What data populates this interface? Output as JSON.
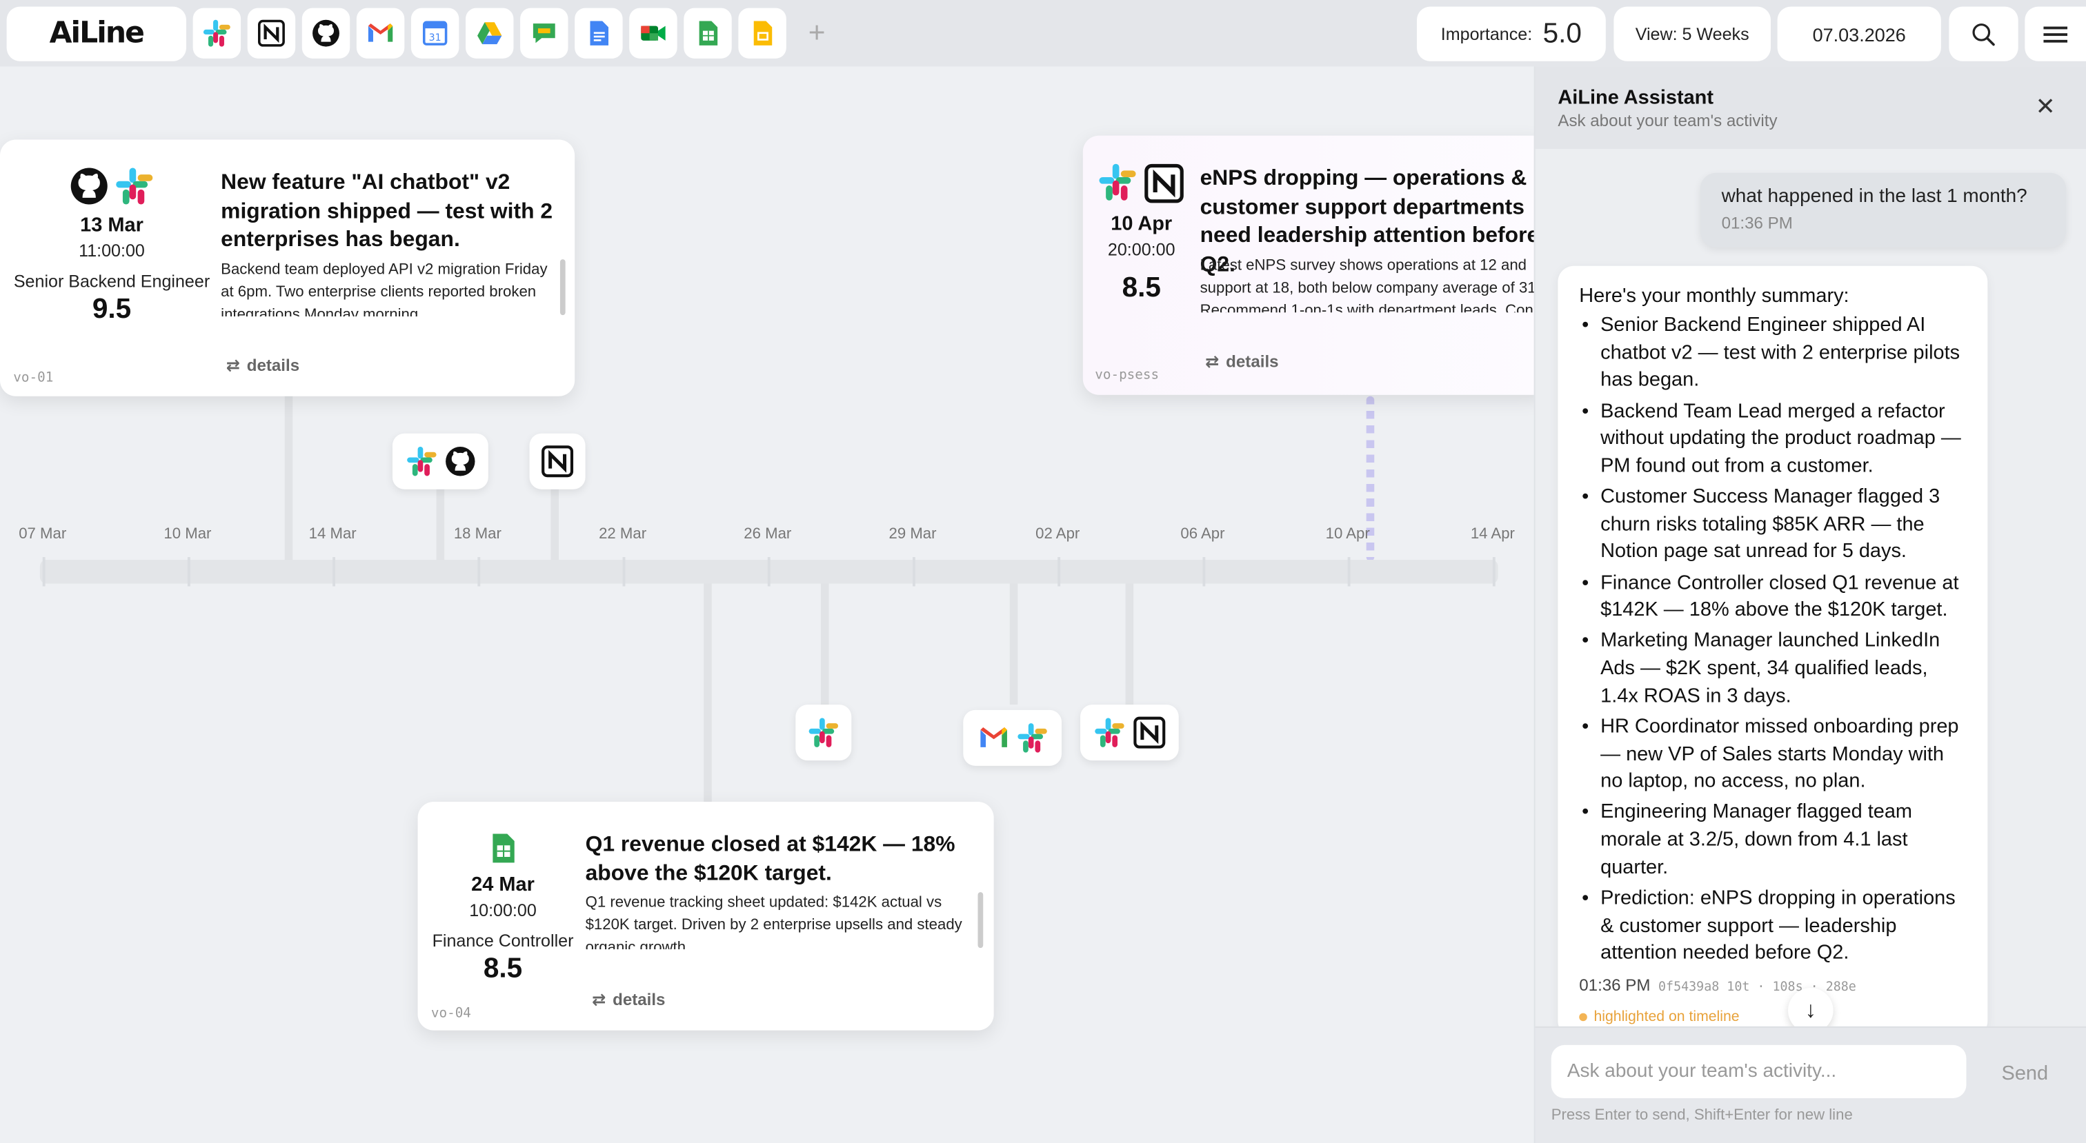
{
  "topbar": {
    "logo": "AiLine",
    "apps": [
      {
        "name": "slack-icon"
      },
      {
        "name": "notion-icon"
      },
      {
        "name": "github-icon"
      },
      {
        "name": "gmail-icon"
      },
      {
        "name": "google-calendar-icon"
      },
      {
        "name": "google-drive-icon"
      },
      {
        "name": "google-chat-icon"
      },
      {
        "name": "google-docs-icon"
      },
      {
        "name": "google-meet-icon"
      },
      {
        "name": "google-sheets-icon"
      },
      {
        "name": "google-slides-icon"
      }
    ],
    "add_icon": "+",
    "importance_label": "Importance:",
    "importance_value": "5.0",
    "view_label": "View: 5 Weeks",
    "date": "07.03.2026"
  },
  "timeline": {
    "ticks": [
      "07 Mar",
      "10 Mar",
      "14 Mar",
      "18 Mar",
      "22 Mar",
      "26 Mar",
      "29 Mar",
      "02 Apr",
      "06 Apr",
      "10 Apr",
      "14 Apr"
    ]
  },
  "cards": [
    {
      "date": "13 Mar",
      "time": "11:00:00",
      "role": "Senior Backend Engineer",
      "score": "9.5",
      "title": "New feature \"AI chatbot\" v2 migration shipped — test with 2 enterprises has began.",
      "body": "Backend team deployed API v2 migration Friday at 6pm. Two enterprise clients reported broken integrations Monday morning.",
      "details": "details",
      "code": "vo-01"
    },
    {
      "date": "10 Apr",
      "time": "20:00:00",
      "role": "",
      "score": "8.5",
      "title": "eNPS dropping — operations & customer support departments need leadership attention before Q2.",
      "body": "Latest eNPS survey shows operations at 12 and support at 18, both below company average of 31. Recommend 1-on-1s with department leads. Consider workload review.",
      "details": "details",
      "code": "vo-psess"
    },
    {
      "date": "24 Mar",
      "time": "10:00:00",
      "role": "Finance Controller",
      "score": "8.5",
      "title": "Q1 revenue closed at $142K — 18% above the $120K target.",
      "body": "Q1 revenue tracking sheet updated: $142K actual vs $120K target. Driven by 2 enterprise upsells and steady organic growth.",
      "details": "details",
      "code": "vo-04"
    }
  ],
  "assistant": {
    "title": "AiLine Assistant",
    "subtitle": "Ask about your team's activity",
    "user_message": "what happened in the last 1 month?",
    "user_time": "01:36 PM",
    "intro": "Here's your monthly summary:",
    "bullets": [
      "Senior Backend Engineer shipped AI chatbot v2 — test with 2 enterprise pilots has began.",
      "Backend Team Lead merged a refactor without updating the product roadmap — PM found out from a customer.",
      "Customer Success Manager flagged 3 churn risks totaling $85K ARR — the Notion page sat unread for 5 days.",
      "Finance Controller closed Q1 revenue at $142K — 18% above the $120K target.",
      "Marketing Manager launched LinkedIn Ads — $2K spent, 34 qualified leads, 1.4x ROAS in 3 days.",
      "HR Coordinator missed onboarding prep — new VP of Sales starts Monday with no laptop, no access, no plan.",
      "Engineering Manager flagged team morale at 3.2/5, down from 4.1 last quarter.",
      "Prediction: eNPS dropping in operations & customer support — leadership attention needed before Q2."
    ],
    "reply_time": "01:36 PM",
    "reply_meta": "0f5439a8  10t · 108s · 288e",
    "highlight": "highlighted on timeline",
    "input_placeholder": "Ask about your team's activity...",
    "send": "Send",
    "hint": "Press Enter to send, Shift+Enter for new line"
  },
  "colors": {
    "accent_dotted": "#c9c6f0",
    "highlight": "#e8a23a"
  }
}
